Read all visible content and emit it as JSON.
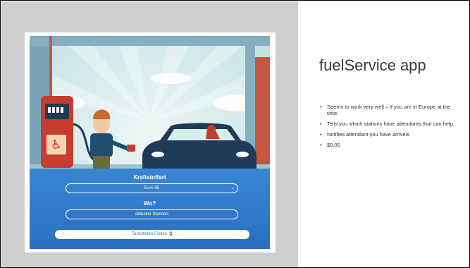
{
  "slide": {
    "title": "fuelService app",
    "bullets": [
      "Seems to work very well – if you are in Europe at the time.",
      "Tells you which stations have attendants that can help.",
      "Notifies attendant you have arrived.",
      "$0.00"
    ]
  },
  "app": {
    "fuel_label": "Kraftstoffart",
    "fuel_value": "Euro 95",
    "location_label": "Wo?",
    "location_placeholder": "aktueller Standort",
    "find_button": "Tankstellen Finden"
  },
  "colors": {
    "sky": "#cfe7ea",
    "pump_red": "#c63d2f",
    "car_navy": "#1f3b57",
    "form_blue": "#2f79c9"
  }
}
